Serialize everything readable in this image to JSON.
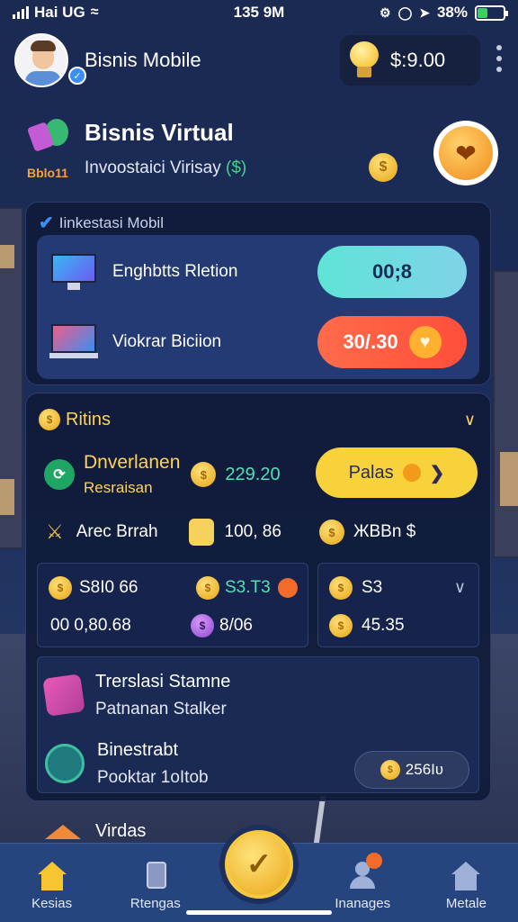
{
  "status": {
    "carrier": "Hai UG",
    "time": "135 9M",
    "battery": "38%"
  },
  "header": {
    "profile_name": "Bisnis Mobile",
    "balance": "$:9.00"
  },
  "hero": {
    "title": "Bisnis Virtual",
    "subtitle": "Invoostaici Virisay",
    "subtitle_accent": "($)",
    "tag": "Bblo11"
  },
  "invest_card": {
    "title": "Iinkestasi Mobil",
    "rows": [
      {
        "label": "Enghbtts Rletion",
        "value": "00;8"
      },
      {
        "label": "Viokrar Biciion",
        "value": "30/.30"
      }
    ]
  },
  "ritins": {
    "title": "Ritins",
    "row1": {
      "title": "Dnverlanen",
      "subtitle": "Resraisan",
      "amount": "229.20",
      "button": "Palas"
    },
    "row2": {
      "label": "Arec Brrah",
      "amount": "100, 86",
      "right": "ЖBBn $"
    },
    "grid": {
      "a1": "S8I0 66",
      "a2": "00 0,80.68",
      "b1": "S3.T3",
      "b2": "8/06",
      "c1": "S3",
      "c2": "45.35"
    }
  },
  "list": [
    {
      "title": "Trerslasi Stamne",
      "subtitle": "Patnanan Stalker"
    },
    {
      "title": "Binestrabt",
      "subtitle": "Pooktar 1oItob",
      "badge": "256Iʋ"
    }
  ],
  "partial_item": "Virdas",
  "nav": [
    "Kesias",
    "Rtengas",
    "Inanages",
    "Metale"
  ],
  "colors": {
    "accent_yellow": "#f7d23a",
    "accent_teal": "#5ee4d6",
    "accent_red": "#ff4e3a",
    "nav_bg": "#26457f"
  }
}
